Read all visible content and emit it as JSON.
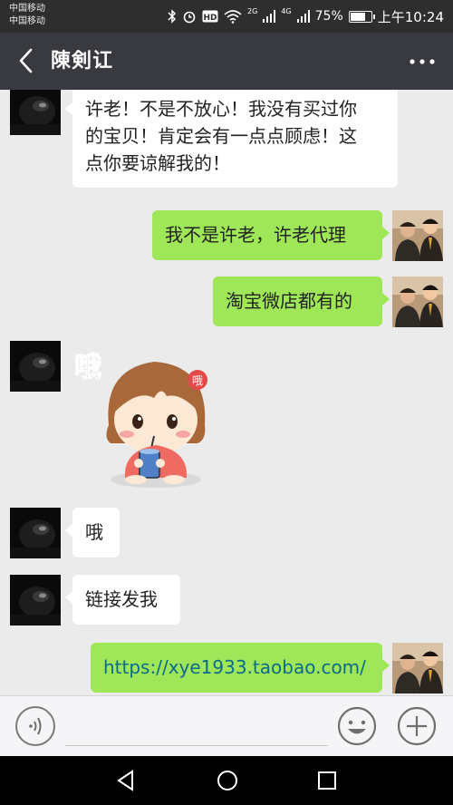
{
  "status_bar": {
    "carrier_1": "中国移动",
    "carrier_2": "中国移动",
    "network_1": "2G",
    "network_2": "4G",
    "battery_percent": "75%",
    "battery_level": 0.75,
    "time": "上午10:24"
  },
  "header": {
    "back_icon": "chevron-left-icon",
    "title": "陳剣讧",
    "more_icon": "ellipsis-icon"
  },
  "messages": [
    {
      "side": "left",
      "type": "text",
      "text_lines": [
        "许老！不是不放心！我没有买过你",
        "的宝贝！肯定会有一点点顾虑！这",
        "点你要谅解我的！"
      ]
    },
    {
      "side": "right",
      "type": "text",
      "text": "我不是许老，许老代理"
    },
    {
      "side": "right",
      "type": "text",
      "text": "淘宝微店都有的"
    },
    {
      "side": "left",
      "type": "sticker",
      "sticker_text": "哦",
      "badge_text": "哦"
    },
    {
      "side": "left",
      "type": "text",
      "text": "哦"
    },
    {
      "side": "left",
      "type": "text",
      "text": "链接发我"
    },
    {
      "side": "right",
      "type": "link",
      "text": "https://xye1933.taobao.com/"
    }
  ],
  "input_bar": {
    "voice_icon": "voice-icon",
    "emoji_icon": "emoji-icon",
    "plus_icon": "plus-icon"
  },
  "system_nav": {
    "back_icon": "triangle-back-icon",
    "home_icon": "circle-home-icon",
    "recents_icon": "square-recents-icon"
  },
  "colors": {
    "status_bar": "#2e2e2e",
    "header": "#393a3f",
    "chat_bg": "#ebebeb",
    "sent_bubble": "#9fe658",
    "received_bubble": "#ffffff",
    "link_text": "#0c6a8a"
  }
}
